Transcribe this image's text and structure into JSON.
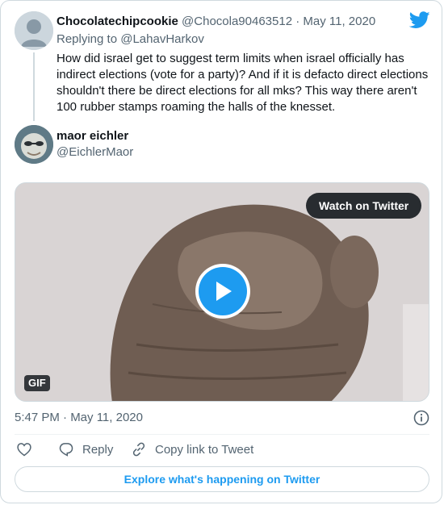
{
  "reply_tweet": {
    "display_name": "Chocolatechipcookie",
    "handle": "@Chocola90463512",
    "separator": "·",
    "date": "May 11, 2020",
    "replying_prefix": "Replying to",
    "replying_to": "@LahavHarkov",
    "text": "How did israel get to suggest  term limits when israel officially has indirect elections (vote for a party)? And if it is defacto direct elections shouldn't there be direct elections for all mks? This way there aren't 100 rubber stamps roaming the halls of the knesset."
  },
  "main_tweet": {
    "display_name": "maor eichler",
    "handle": "@EichlerMaor",
    "watch_label": "Watch on Twitter",
    "media_badge": "GIF",
    "timestamp": "5:47 PM · May 11, 2020"
  },
  "actions": {
    "reply_label": "Reply",
    "copy_link_label": "Copy link to Tweet"
  },
  "explore_label": "Explore what's happening on Twitter",
  "colors": {
    "accent": "#1d9bf0",
    "text_primary": "#0f1419",
    "text_secondary": "#536471",
    "border": "#cfd9de"
  },
  "icons": [
    "twitter-bird-icon",
    "play-icon",
    "info-icon",
    "heart-icon",
    "reply-bubble-icon",
    "link-icon"
  ]
}
